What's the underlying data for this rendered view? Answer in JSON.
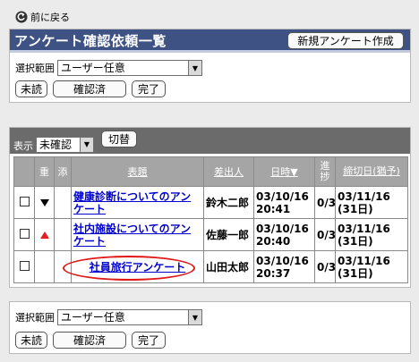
{
  "nav": {
    "back_label": "前に戻る"
  },
  "header": {
    "title": "アンケート確認依頼一覧",
    "new_button": "新規アンケート作成"
  },
  "filter": {
    "scope_label": "選択範囲",
    "scope_value": "ユーザー任意",
    "buttons": {
      "unread": "未読",
      "confirmed": "確認済",
      "done": "完了"
    }
  },
  "list": {
    "view_label": "表示",
    "view_value": "未確認",
    "switch_button": "切替",
    "columns": {
      "priority": "重",
      "attachment": "添",
      "subject": "表題",
      "sender": "差出人",
      "datetime": "日時▼",
      "progress": "進捗",
      "deadline": "締切日(猶予)"
    },
    "rows": [
      {
        "priority": "low",
        "subject": "健康診断についてのアンケート",
        "sender": "鈴木二郎",
        "datetime": "03/10/16 20:41",
        "progress": "0/3",
        "deadline": "03/11/16 (31日)"
      },
      {
        "priority": "high",
        "subject": "社内施設についてのアンケート",
        "sender": "佐藤一郎",
        "datetime": "03/10/16 20:40",
        "progress": "0/3",
        "deadline": "03/11/16 (31日)"
      },
      {
        "priority": "none",
        "subject": "社員旅行アンケート",
        "sender": "山田太郎",
        "datetime": "03/10/16 20:37",
        "progress": "0/3",
        "deadline": "03/11/16 (31日)"
      }
    ]
  },
  "colors": {
    "title_bar": "#3e5284",
    "list_bar": "#6b6b6b",
    "header_cell": "#a5a5a5",
    "link": "#0000cc",
    "highlight": "#e01818"
  }
}
